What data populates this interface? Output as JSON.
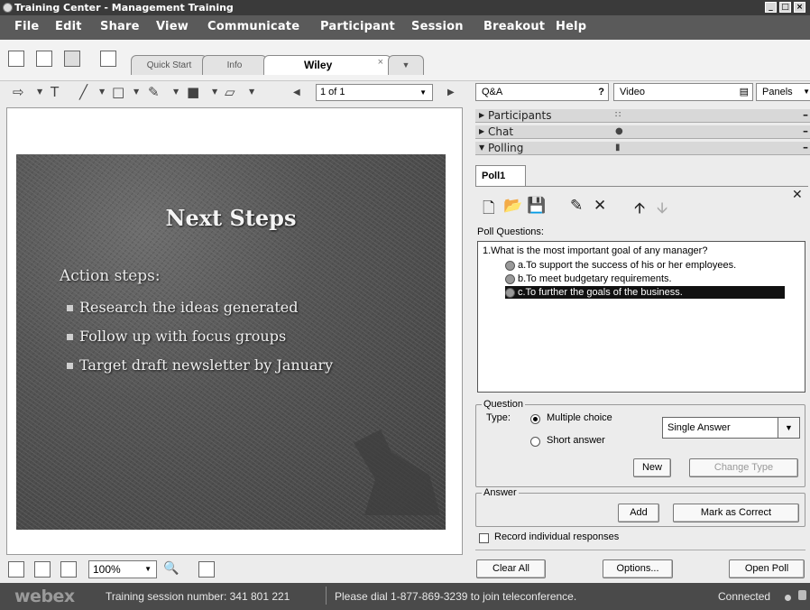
{
  "window": {
    "title": "Training Center - Management Training",
    "minimize": "_",
    "maximize": "□",
    "close": "×"
  },
  "menu": [
    "File",
    "Edit",
    "Share",
    "View",
    "Communicate",
    "Participant",
    "Session",
    "Breakout",
    "Help"
  ],
  "tabs": {
    "quick_start": "Quick Start",
    "info": "Info",
    "document": "Wiley",
    "close_glyph": "×"
  },
  "annot": {
    "page": "1 of 1",
    "arrow_glyph": "⇨",
    "text_glyph": "T",
    "line_glyph": "╱",
    "rect_glyph": "□",
    "pen_glyph": "✎",
    "color_glyph": "■",
    "eraser_glyph": "▱"
  },
  "slide": {
    "title": "Next Steps",
    "subtitle": "Action steps:",
    "bullets": [
      "Research the ideas generated",
      "Follow up with focus groups",
      "Target draft newsletter by January"
    ]
  },
  "bottom": {
    "zoom": "100%"
  },
  "right": {
    "qa": "Q&A",
    "video": "Video",
    "panels": "Panels"
  },
  "sections": {
    "participants": "Participants",
    "chat": "Chat",
    "polling": "Polling"
  },
  "poll": {
    "tab": "Poll1",
    "questions_label": "Poll Questions:",
    "question": "1.What is the most important goal of any manager?",
    "options": [
      "a.To support the success of his or her employees.",
      "b.To meet budgetary requirements.",
      "c.To further the goals of the business."
    ],
    "question_group": "Question",
    "type_label": "Type:",
    "multiple_choice": "Multiple choice",
    "short_answer": "Short answer",
    "answer_mode": "Single Answer",
    "new_btn": "New",
    "change_type_btn": "Change Type",
    "answer_group": "Answer",
    "add_btn": "Add",
    "mark_correct_btn": "Mark as Correct",
    "record_label": "Record individual responses",
    "clear_all": "Clear All",
    "options_btn": "Options...",
    "open_poll": "Open Poll"
  },
  "status": {
    "logo": "webex",
    "session": "Training session number: 341 801 221",
    "dial": "Please dial 1-877-869-3239 to join teleconference.",
    "connected": "Connected"
  }
}
